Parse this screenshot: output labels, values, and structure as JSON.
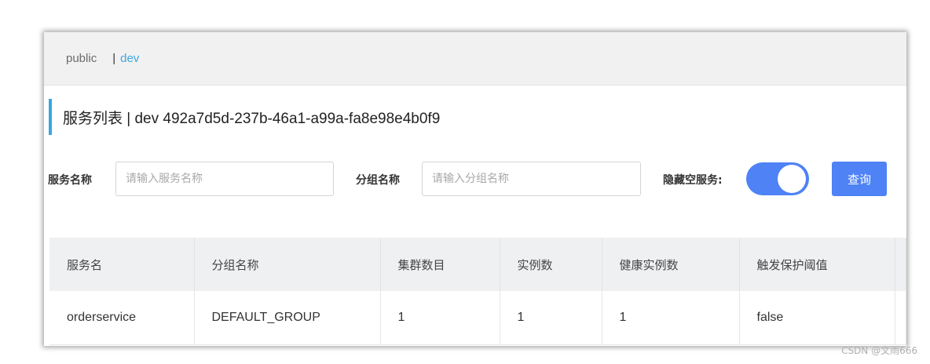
{
  "namespaces": {
    "public_label": "public",
    "separator": "|",
    "active_label": "dev"
  },
  "header": {
    "title": "服务列表 | dev 492a7d5d-237b-46a1-a99a-fa8e98e4b0f9"
  },
  "filters": {
    "service_name_label": "服务名称",
    "service_name_placeholder": "请输入服务名称",
    "group_name_label": "分组名称",
    "group_name_placeholder": "请输入分组名称",
    "hide_empty_label": "隐藏空服务:",
    "hide_empty_enabled": true,
    "query_label": "查询"
  },
  "table": {
    "headers": [
      "服务名",
      "分组名称",
      "集群数目",
      "实例数",
      "健康实例数",
      "触发保护阈值"
    ],
    "rows": [
      [
        "orderservice",
        "DEFAULT_GROUP",
        "1",
        "1",
        "1",
        "false"
      ]
    ]
  },
  "watermark": "CSDN @文雨666",
  "colors": {
    "accent": "#39a7e0",
    "primary_button": "#4e82f5"
  }
}
